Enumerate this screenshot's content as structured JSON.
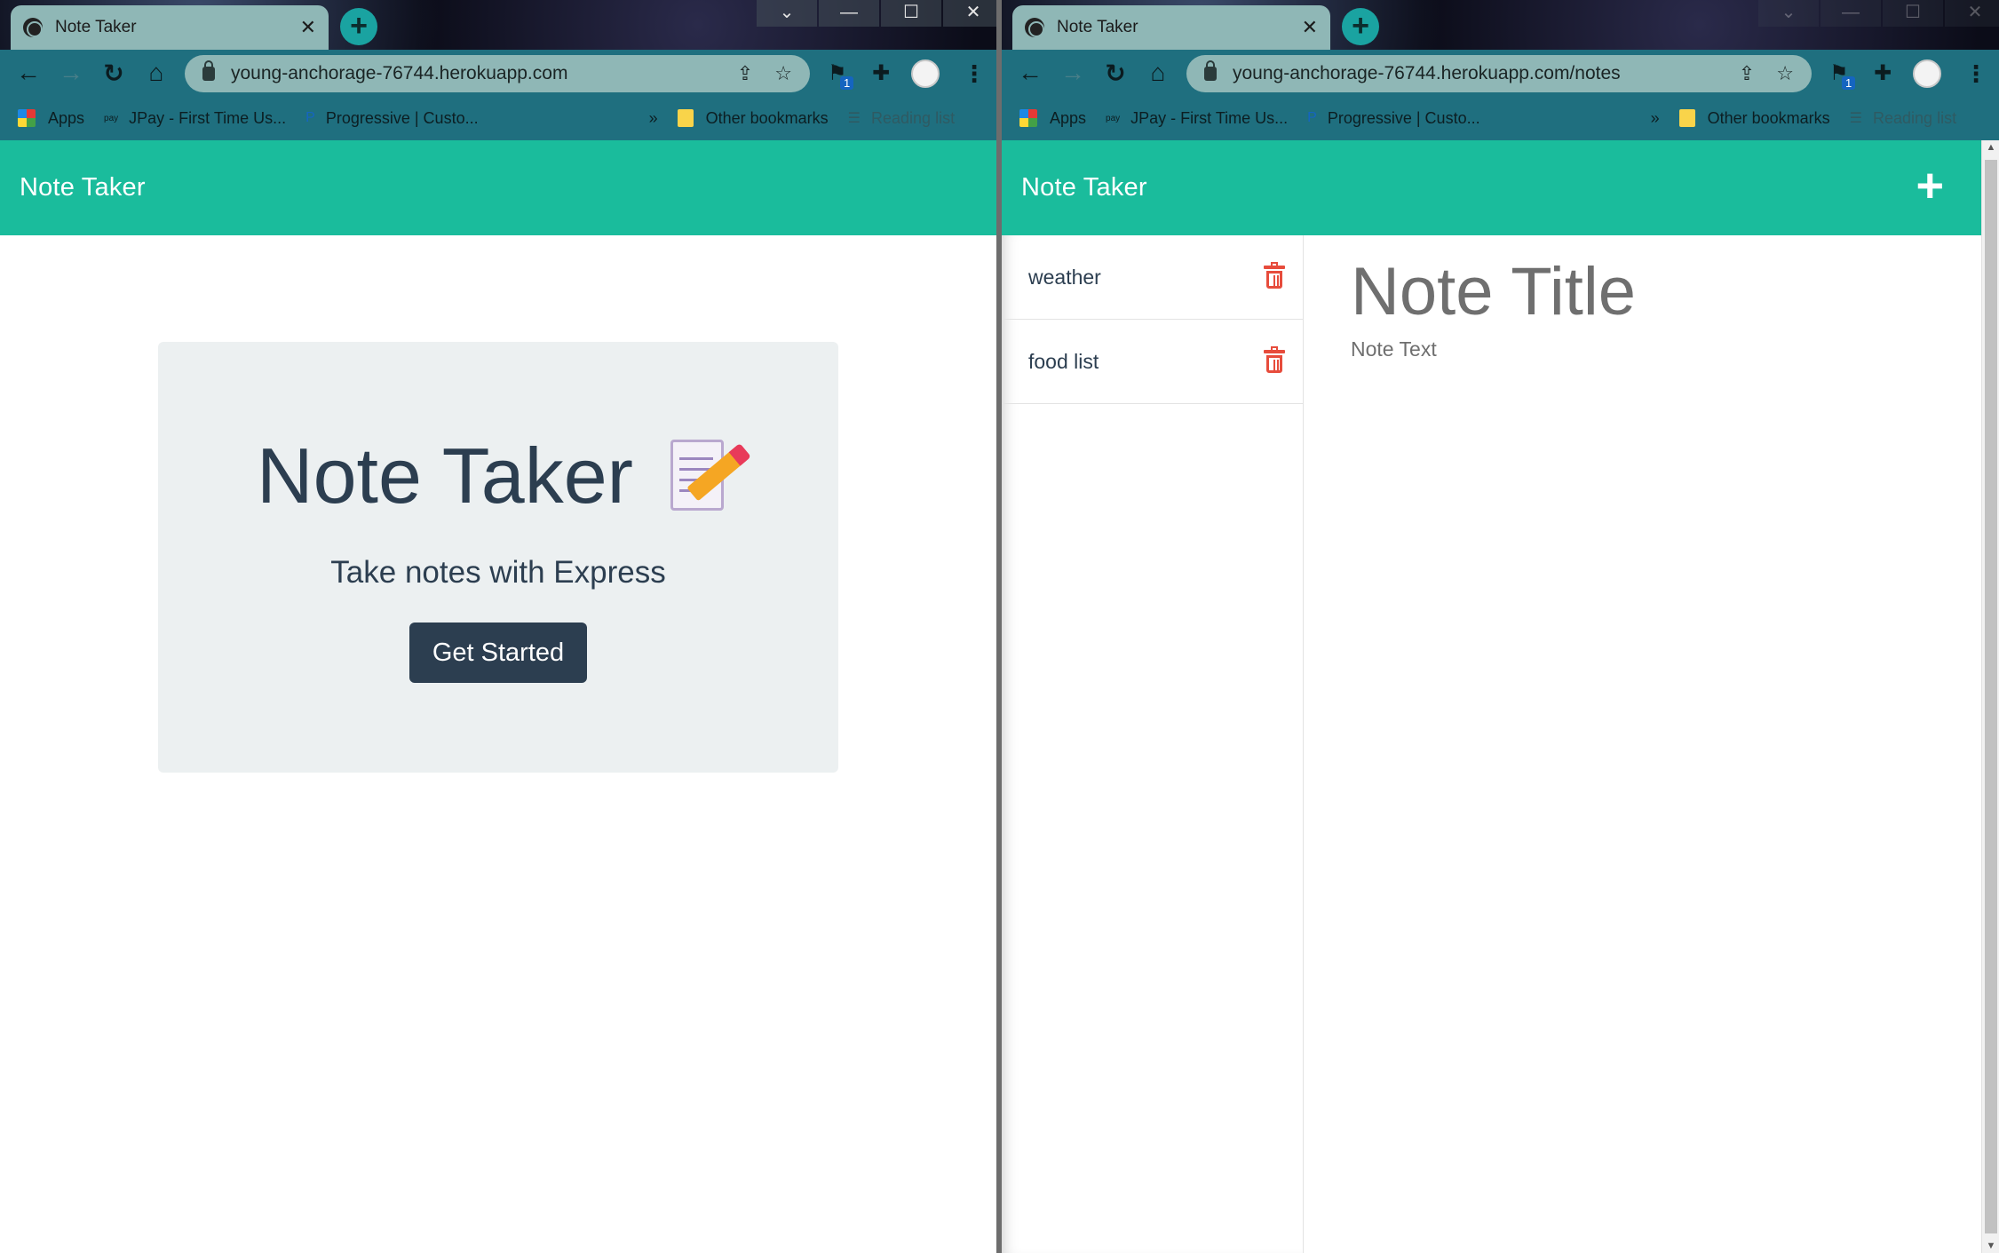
{
  "left": {
    "tab_title": "Note Taker",
    "url": "young-anchorage-76744.herokuapp.com",
    "bookmarks": [
      "Apps",
      "JPay - First Time Us...",
      "Progressive | Custo...",
      "»",
      "Other bookmarks",
      "Reading list"
    ],
    "brand": "Note Taker",
    "hero_title": "Note Taker",
    "hero_subtitle": "Take notes with Express",
    "cta": "Get Started"
  },
  "right": {
    "tab_title": "Note Taker",
    "url": "young-anchorage-76744.herokuapp.com/notes",
    "bookmarks": [
      "Apps",
      "JPay - First Time Us...",
      "Progressive | Custo...",
      "»",
      "Other bookmarks",
      "Reading list"
    ],
    "brand": "Note Taker",
    "new_note_icon": "+",
    "notes": [
      {
        "title": "weather"
      },
      {
        "title": "food list"
      }
    ],
    "title_placeholder": "Note Title",
    "text_placeholder": "Note Text"
  },
  "browser": {
    "extension_badge": "1"
  },
  "colors": {
    "navbar": "#1abc9c",
    "jumbotron": "#ecf0f1",
    "button": "#2c3e50",
    "trash": "#e74c3c",
    "tab": "#8fb7b6",
    "toolbar": "#1f6f7f"
  }
}
